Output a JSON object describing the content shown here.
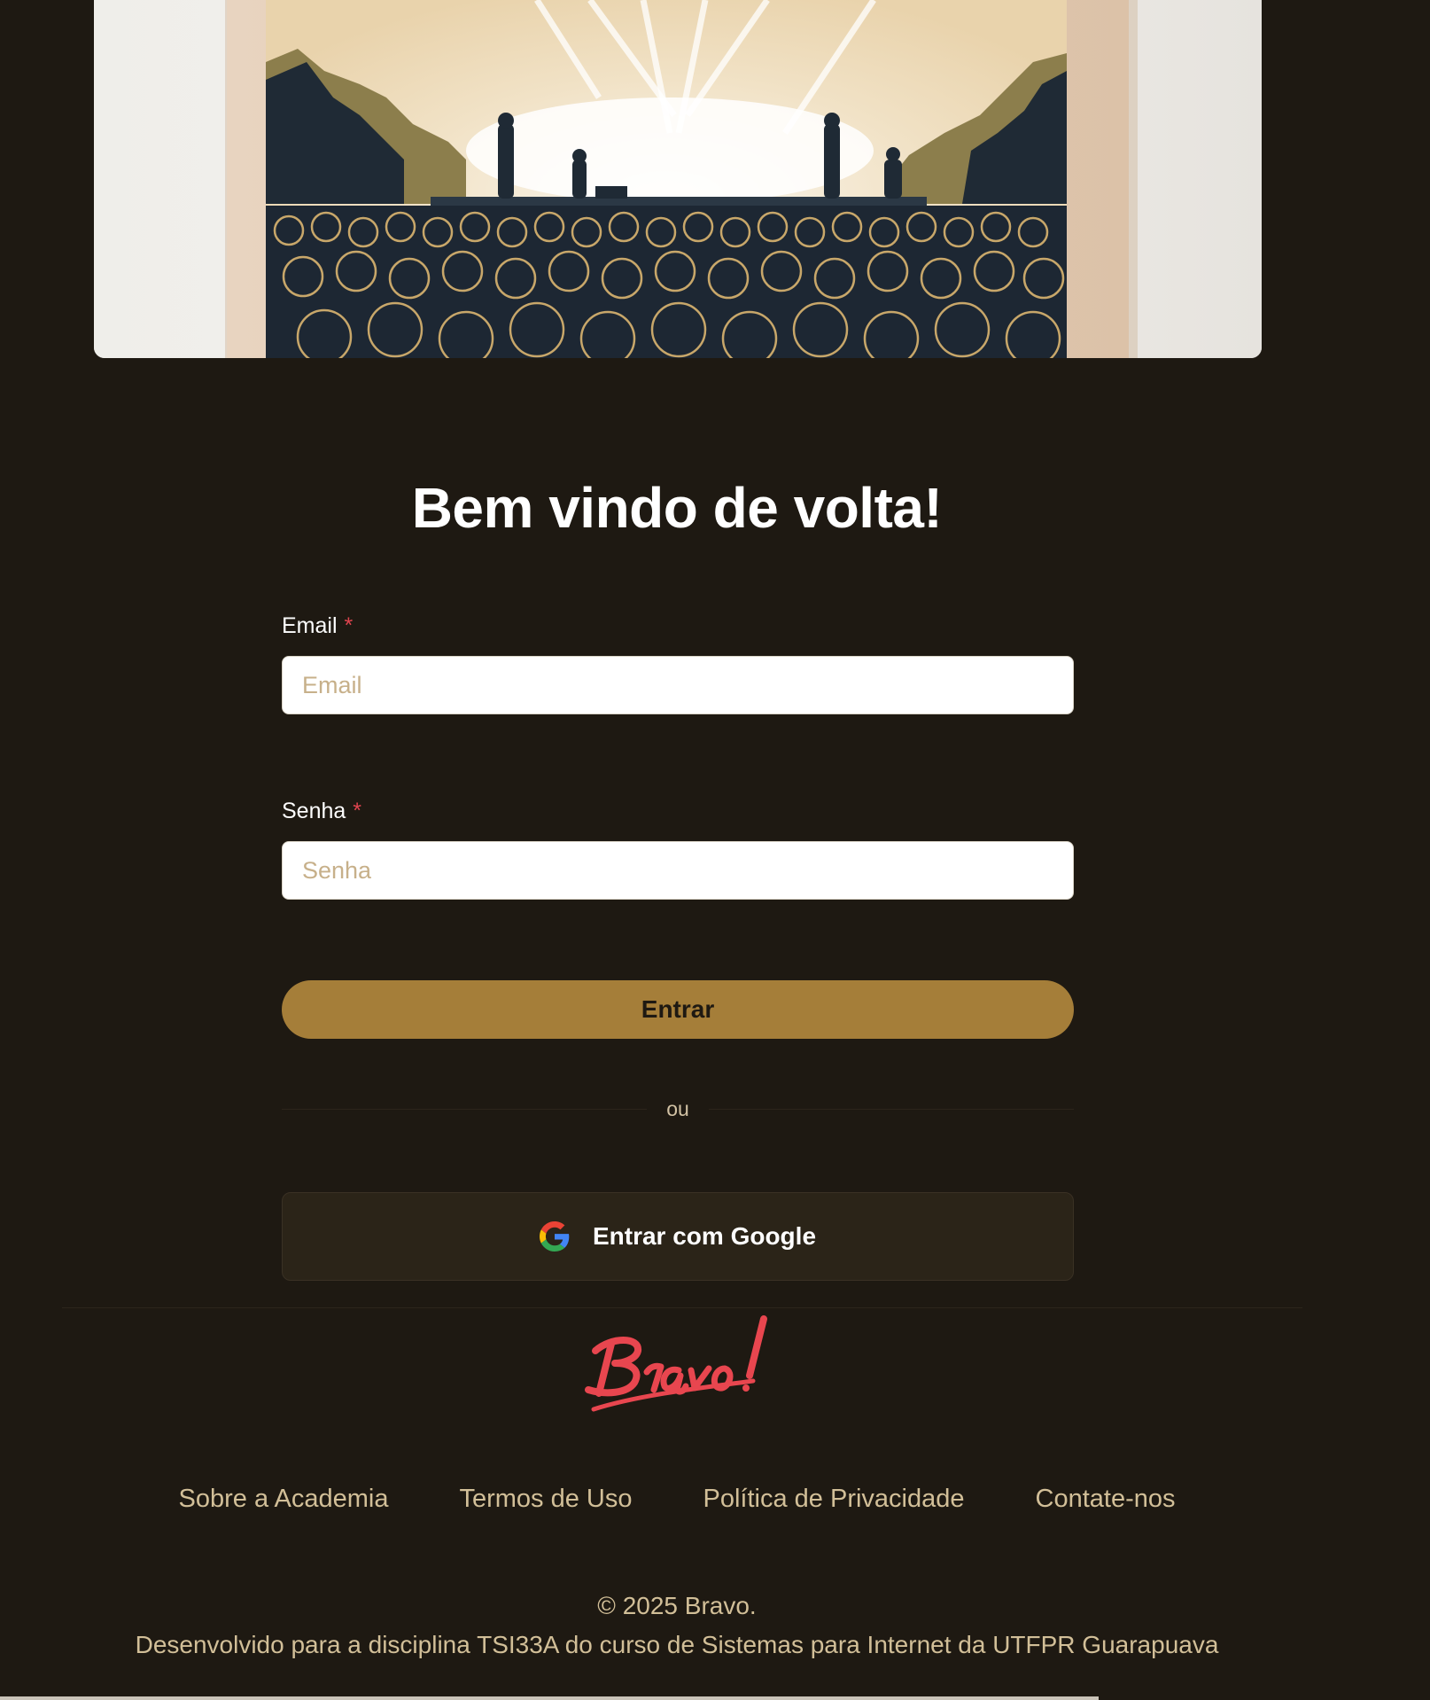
{
  "hero": {
    "image_alt": "Ilustração de um show com plateia diante de um palco iluminado"
  },
  "login": {
    "title": "Bem vindo de volta!",
    "email": {
      "label": "Email",
      "required_mark": "*",
      "placeholder": "Email",
      "value": ""
    },
    "senha": {
      "label": "Senha",
      "required_mark": "*",
      "placeholder": "Senha",
      "value": ""
    },
    "submit_label": "Entrar",
    "divider_text": "ou",
    "google_label": "Entrar com Google"
  },
  "footer": {
    "logo_text": "Bravo!",
    "links": [
      {
        "label": "Sobre a Academia"
      },
      {
        "label": "Termos de Uso"
      },
      {
        "label": "Política de Privacidade"
      },
      {
        "label": "Contate-nos"
      }
    ],
    "copyright": "© 2025 Bravo.",
    "credit": "Desenvolvido para a disciplina TSI33A do curso de Sistemas para Internet da UTFPR Guarapuava"
  },
  "colors": {
    "background": "#1e1912",
    "accent": "#a57e39",
    "required": "#e0444f",
    "link": "#d2bf98",
    "logo": "#e8464f"
  }
}
